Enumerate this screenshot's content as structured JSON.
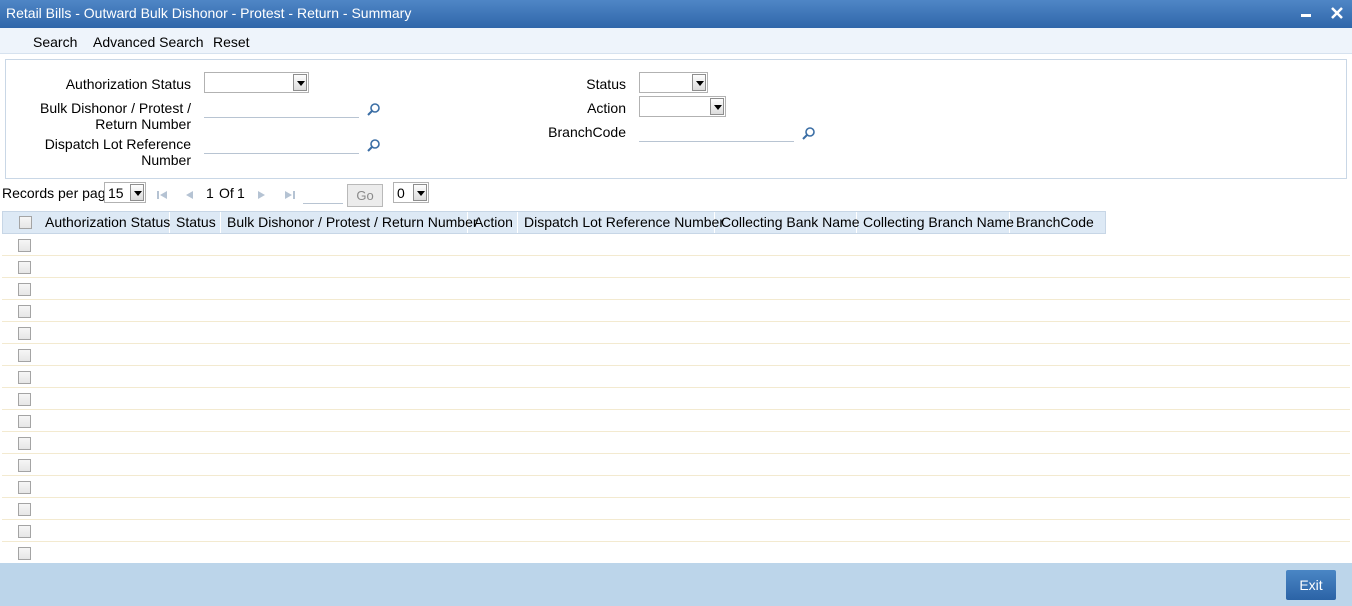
{
  "window": {
    "title": "Retail Bills - Outward Bulk Dishonor - Protest - Return - Summary",
    "minimize_label": "‒",
    "close_label": "✕"
  },
  "menu": {
    "search": "Search",
    "advanced_search": "Advanced Search",
    "reset": "Reset"
  },
  "criteria": {
    "authorization_status": {
      "label": "Authorization Status",
      "value": ""
    },
    "bulk_number": {
      "label_line1": "Bulk Dishonor / Protest /",
      "label_line2": "Return Number",
      "value": ""
    },
    "dispatch_lot": {
      "label_line1": "Dispatch Lot Reference",
      "label_line2": "Number",
      "value": ""
    },
    "status": {
      "label": "Status",
      "value": ""
    },
    "action": {
      "label": "Action",
      "value": ""
    },
    "branch_code": {
      "label": "BranchCode",
      "value": ""
    }
  },
  "pager": {
    "records_per_page_label": "Records per page",
    "records_per_page": "15",
    "current_page": "1",
    "of_label": "Of",
    "total_pages": "1",
    "go_label": "Go",
    "page_input": "",
    "extra_select": "0"
  },
  "grid": {
    "columns": [
      "Authorization Status",
      "Status",
      "Bulk Dishonor / Protest / Return Number",
      "Action",
      "Dispatch Lot Reference Number",
      "Collecting Bank Name",
      "Collecting Branch Name",
      "BranchCode"
    ],
    "row_count": 15
  },
  "footer": {
    "exit_label": "Exit"
  },
  "colors": {
    "title_bar": "#2f66aa",
    "footer": "#bcd5ea",
    "header_row": "#dde9f5",
    "exit_button": "#2b63a6"
  }
}
